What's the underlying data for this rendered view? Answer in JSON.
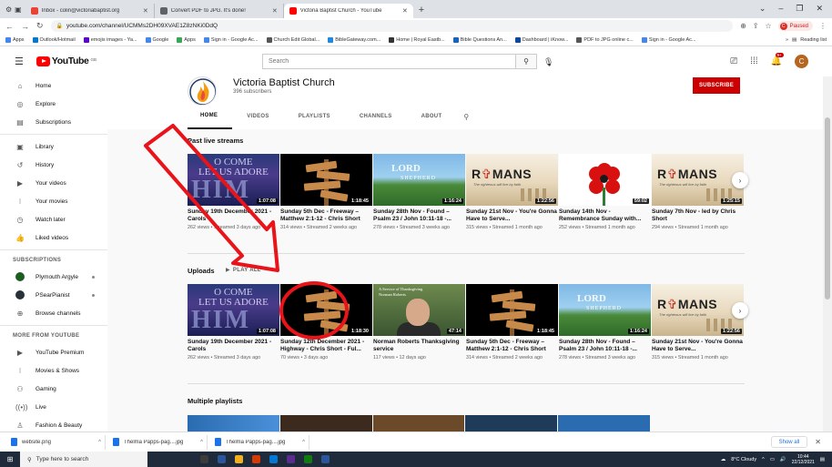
{
  "browser": {
    "tabs": [
      {
        "label": "Inbox - colin@victoriabaptist.org",
        "favicon_color": "#ea4335",
        "active": false
      },
      {
        "label": "Convert PDF to JPG. It's done!",
        "favicon_color": "#5f6368",
        "active": false
      },
      {
        "label": "Victoria Baptist Church - YouTube",
        "favicon_color": "#ff0000",
        "active": true
      }
    ],
    "new_tab": "+",
    "url": "youtube.com/channel/UCMMs2DH09XVAE1Z8zNKi0DdQ",
    "profile_status": "Paused",
    "profile_initial": "C",
    "bookmarks": [
      {
        "label": "Apps",
        "color": "#4285f4"
      },
      {
        "label": "Outlook/Hotmail",
        "color": "#0078d4"
      },
      {
        "label": "emojis images - Ya...",
        "color": "#6001d2"
      },
      {
        "label": "Google",
        "color": "#4285f4"
      },
      {
        "label": "Apps",
        "color": "#34a853"
      },
      {
        "label": "Sign in - Google Ac...",
        "color": "#4285f4"
      },
      {
        "label": "Church Edit Global...",
        "color": "#555555"
      },
      {
        "label": "BibleGateway.com...",
        "color": "#1e88e5"
      },
      {
        "label": "Home | Royal Eastb...",
        "color": "#333333"
      },
      {
        "label": "Bible Questions An...",
        "color": "#1565c0"
      },
      {
        "label": "Dashboard | iKnow...",
        "color": "#0d47a1"
      },
      {
        "label": "PDF to JPG online c...",
        "color": "#555555"
      },
      {
        "label": "Sign in - Google Ac...",
        "color": "#4285f4"
      }
    ],
    "reading_list": "Reading list"
  },
  "youtube": {
    "logo_text": "YouTube",
    "logo_suffix": "GB",
    "search_placeholder": "Search",
    "notifications_badge": "9+",
    "avatar_initial": "C"
  },
  "sidebar": {
    "primary": [
      {
        "label": "Home",
        "icon": "⌂",
        "name": "home"
      },
      {
        "label": "Explore",
        "icon": "◎",
        "name": "explore"
      },
      {
        "label": "Subscriptions",
        "icon": "▤",
        "name": "subscriptions"
      }
    ],
    "library": [
      {
        "label": "Library",
        "icon": "▣",
        "name": "library"
      },
      {
        "label": "History",
        "icon": "↺",
        "name": "history"
      },
      {
        "label": "Your videos",
        "icon": "▶",
        "name": "your-videos"
      },
      {
        "label": "Your movies",
        "icon": "⁝",
        "name": "your-movies"
      },
      {
        "label": "Watch later",
        "icon": "◷",
        "name": "watch-later"
      },
      {
        "label": "Liked videos",
        "icon": "👍",
        "name": "liked-videos"
      }
    ],
    "subscriptions_heading": "SUBSCRIPTIONS",
    "subscriptions": [
      {
        "label": "Plymouth Argyle",
        "color": "#1b5e20"
      },
      {
        "label": "PSearPianist",
        "color": "#263238"
      },
      {
        "label": "Browse channels",
        "icon": "⊕"
      }
    ],
    "more_heading": "MORE FROM YOUTUBE",
    "more": [
      {
        "label": "YouTube Premium",
        "icon": "▶",
        "name": "youtube-premium"
      },
      {
        "label": "Movies & Shows",
        "icon": "⁝",
        "name": "movies-shows"
      },
      {
        "label": "Gaming",
        "icon": "⚇",
        "name": "gaming"
      },
      {
        "label": "Live",
        "icon": "((•))",
        "name": "live"
      },
      {
        "label": "Fashion & Beauty",
        "icon": "♙",
        "name": "fashion-beauty"
      }
    ]
  },
  "channel": {
    "name": "Victoria Baptist Church",
    "subscribers": "396 subscribers",
    "subscribe_label": "SUBSCRIBE",
    "tabs": [
      "HOME",
      "VIDEOS",
      "PLAYLISTS",
      "CHANNELS",
      "ABOUT"
    ],
    "active_tab": "HOME"
  },
  "sections": {
    "past_live": "Past live streams",
    "uploads": "Uploads",
    "play_all": "PLAY ALL",
    "playlists": "Multiple playlists"
  },
  "past_live_videos": [
    {
      "thumb": "ocome",
      "duration": "1:07:08",
      "title": "Sunday 19th December 2021 - Carols",
      "views": "262 views",
      "age": "Streamed 3 days ago"
    },
    {
      "thumb": "sign",
      "duration": "1:18:45",
      "title": "Sunday 5th Dec - Freeway – Matthew 2:1-12 - Chris Short",
      "views": "314 views",
      "age": "Streamed 2 weeks ago"
    },
    {
      "thumb": "shep",
      "duration": "1:16:24",
      "title": "Sunday 28th Nov - Found – Psalm 23 / John 10:11-18 -...",
      "views": "278 views",
      "age": "Streamed 3 weeks ago"
    },
    {
      "thumb": "rom",
      "duration": "1:22:56",
      "title": "Sunday 21st Nov - You're Gonna Have to Serve...",
      "views": "315 views",
      "age": "Streamed 1 month ago"
    },
    {
      "thumb": "poppy",
      "duration": "59:02",
      "title": "Sunday 14th Nov - Remembrance Sunday with...",
      "views": "252 views",
      "age": "Streamed 1 month ago"
    },
    {
      "thumb": "rom",
      "duration": "1:25:15",
      "title": "Sunday 7th Nov - led by Chris Short",
      "views": "294 views",
      "age": "Streamed 1 month ago"
    }
  ],
  "upload_videos": [
    {
      "thumb": "ocome",
      "duration": "1:07:08",
      "title": "Sunday 19th December 2021 - Carols",
      "views": "262 views",
      "age": "Streamed 3 days ago"
    },
    {
      "thumb": "sign",
      "duration": "1:18:30",
      "title": "Sunday 12th December 2021 - Highway - Chris Short - Ful...",
      "views": "70 views",
      "age": "3 days ago"
    },
    {
      "thumb": "thanks",
      "duration": "47:14",
      "title": "Norman Roberts Thanksgiving service",
      "views": "117 views",
      "age": "12 days ago"
    },
    {
      "thumb": "sign",
      "duration": "1:18:45",
      "title": "Sunday 5th Dec - Freeway – Matthew 2:1-12 - Chris Short",
      "views": "314 views",
      "age": "Streamed 2 weeks ago"
    },
    {
      "thumb": "shep",
      "duration": "1:16:24",
      "title": "Sunday 28th Nov - Found – Psalm 23 / John 10:11-18 -...",
      "views": "278 views",
      "age": "Streamed 3 weeks ago"
    },
    {
      "thumb": "rom",
      "duration": "1:22:56",
      "title": "Sunday 21st Nov - You're Gonna Have to Serve...",
      "views": "315 views",
      "age": "Streamed 1 month ago"
    }
  ],
  "thumb_text": {
    "ocome_line1": "O COME",
    "ocome_line2": "LET US ADORE",
    "ocome_big": "HIM",
    "lord": "LORD",
    "shepherd": "SHEPHERD",
    "romans_r": "R",
    "romans_o": "✞",
    "romans_rest": "MANS",
    "romans_sub": "The righteous will live by faith",
    "thanks_caption_1": "A Service of Thanksgiving",
    "thanks_caption_2": "Norman Roberts"
  },
  "downloads": [
    {
      "label": "website.png"
    },
    {
      "label": "Thelma Papps-pag....jpg"
    },
    {
      "label": "Thelma Papps-pag....jpg"
    }
  ],
  "downloads_show_all": "Show all",
  "taskbar": {
    "search_placeholder": "Type here to search",
    "weather": "8°C  Cloudy",
    "time": "10:44",
    "date": "22/12/2021",
    "apps": [
      "#3c3c3c",
      "#2b579a",
      "#f2b01e",
      "#d83b01",
      "#0078d4",
      "#5c2d91",
      "#107c10",
      "#2b579a"
    ]
  },
  "colors": {
    "accent_red": "#ff0000",
    "subscribe_red": "#cc0000",
    "annotation_red": "#e8141a"
  }
}
